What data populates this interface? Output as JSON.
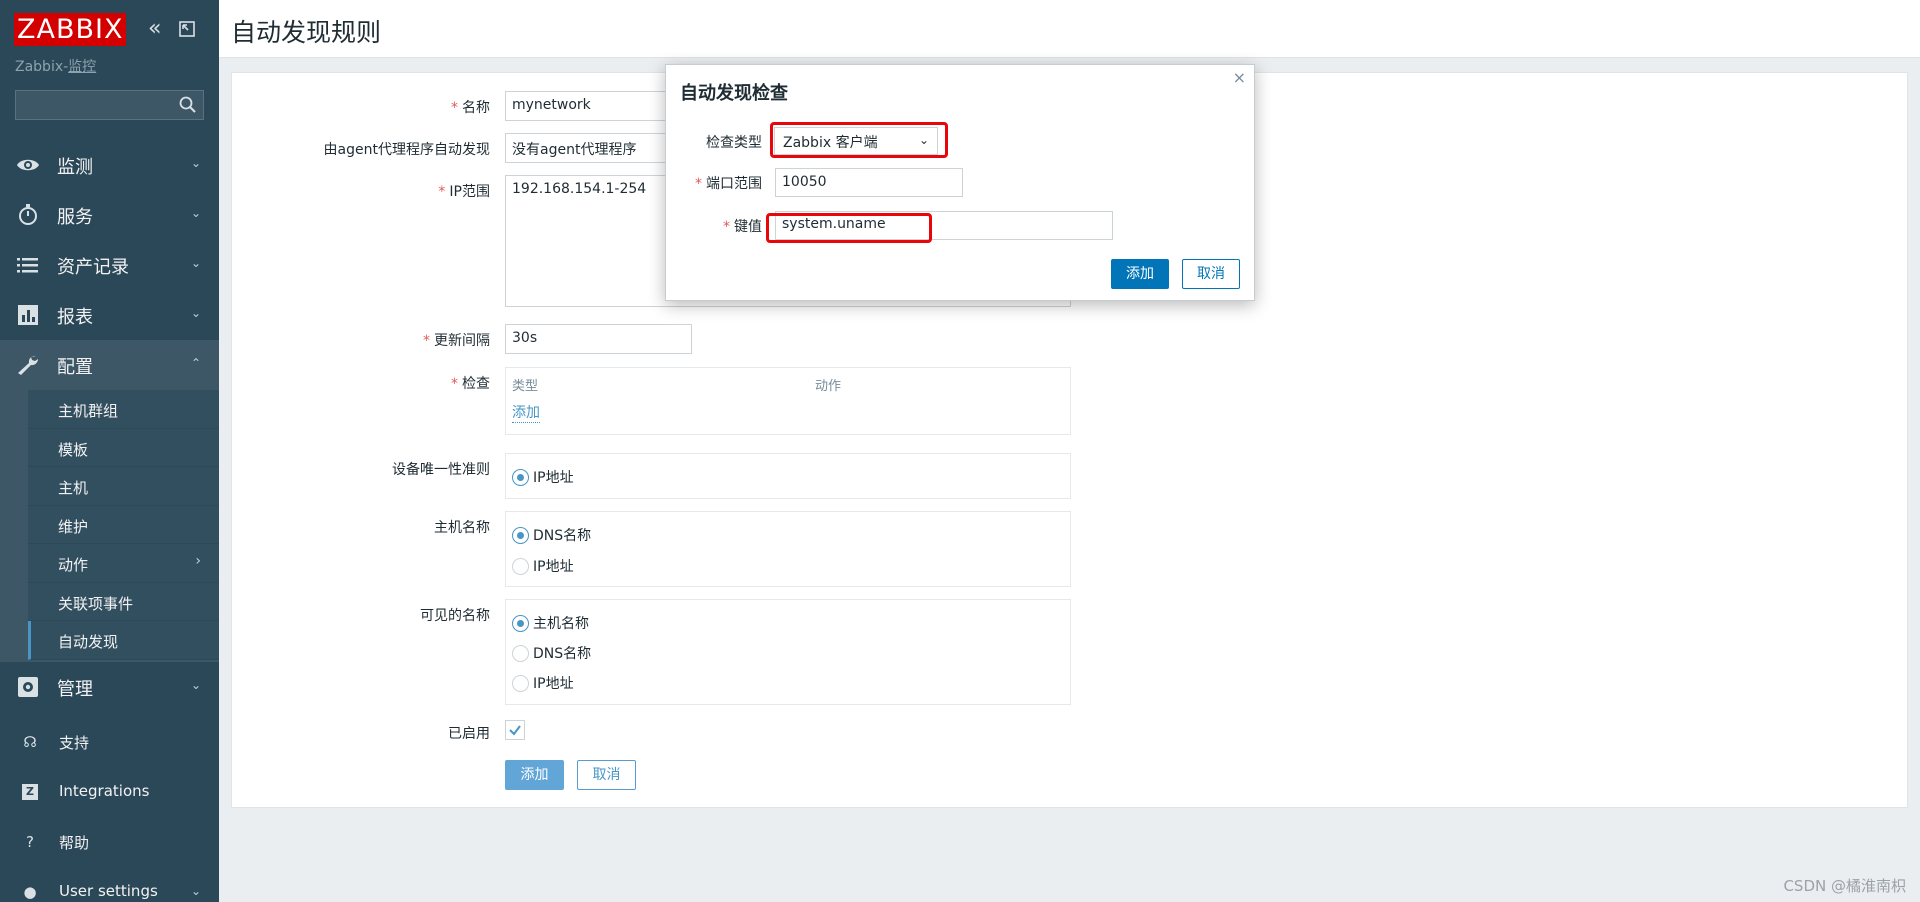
{
  "sidebar": {
    "logo": "ZABBIX",
    "server_name_prefix": "Zabbix-",
    "server_name_link": "监控",
    "search": {
      "value": "",
      "placeholder": ""
    },
    "nav": {
      "monitoring": "监测",
      "services": "服务",
      "inventory": "资产记录",
      "reports": "报表",
      "configuration": "配置",
      "administration": "管理"
    },
    "sub_nav": {
      "host_groups": "主机群组",
      "templates": "模板",
      "hosts": "主机",
      "maintenance": "维护",
      "actions": "动作",
      "event_correlation": "关联项事件",
      "discovery": "自动发现"
    },
    "footer": {
      "support": "支持",
      "integrations": "Integrations",
      "help": "帮助",
      "user_settings": "User settings"
    }
  },
  "header": {
    "title": "自动发现规则"
  },
  "form": {
    "name": {
      "label": "名称",
      "value": "mynetwork"
    },
    "proxy": {
      "label": "由agent代理程序自动发现",
      "value": "没有agent代理程序"
    },
    "ip_range": {
      "label": "IP范围",
      "value": "192.168.154.1-254"
    },
    "update_interval": {
      "label": "更新间隔",
      "value": "30s"
    },
    "checks": {
      "label": "检查",
      "col_type": "类型",
      "col_action": "动作",
      "add_link": "添加"
    },
    "uniqueness": {
      "label": "设备唯一性准则",
      "options": [
        "IP地址"
      ]
    },
    "host_name": {
      "label": "主机名称",
      "options": [
        "DNS名称",
        "IP地址"
      ]
    },
    "visible_name": {
      "label": "可见的名称",
      "options": [
        "主机名称",
        "DNS名称",
        "IP地址"
      ]
    },
    "enabled": {
      "label": "已启用",
      "checked": true
    },
    "buttons": {
      "add": "添加",
      "cancel": "取消"
    }
  },
  "modal": {
    "title": "自动发现检查",
    "check_type": {
      "label": "检查类型",
      "value": "Zabbix 客户端"
    },
    "port_range": {
      "label": "端口范围",
      "value": "10050"
    },
    "key": {
      "label": "键值",
      "value": "system.uname"
    },
    "buttons": {
      "add": "添加",
      "cancel": "取消"
    },
    "close": "×"
  },
  "watermark": "CSDN @橘淮南枳",
  "colors": {
    "sidebar_bg": "#2b4859",
    "accent": "#4796c4",
    "modal_primary": "#0275b8",
    "highlight": "#e8060b",
    "required": "#e45959",
    "logo_bg": "#d40000"
  }
}
